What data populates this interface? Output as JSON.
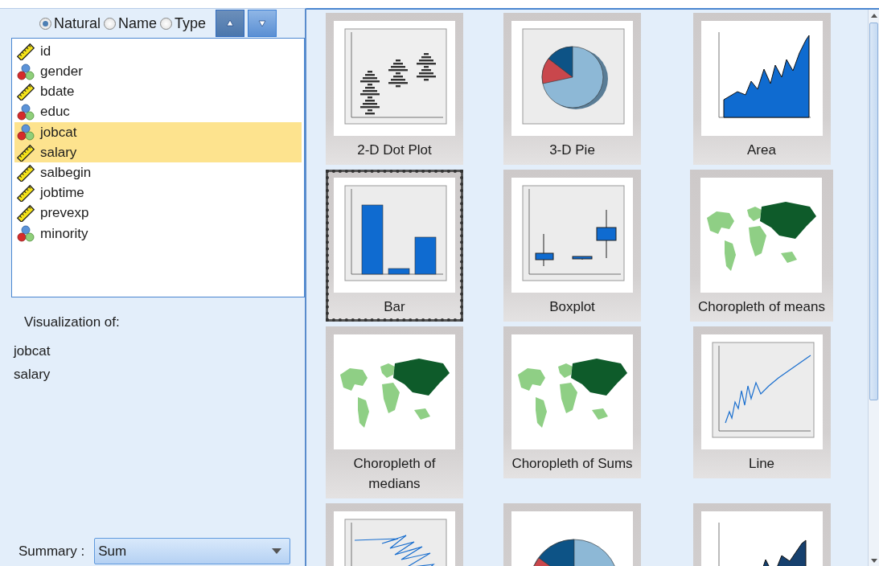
{
  "sort_options": [
    {
      "label": "Natural",
      "selected": true
    },
    {
      "label": "Name",
      "selected": false
    },
    {
      "label": "Type",
      "selected": false
    }
  ],
  "sort_buttons": [
    {
      "kind": "ascending",
      "selected": true
    },
    {
      "kind": "descending",
      "selected": false
    }
  ],
  "variables": [
    {
      "name": "id",
      "kind": "scale",
      "selected": false
    },
    {
      "name": "gender",
      "kind": "nominal",
      "selected": false
    },
    {
      "name": "bdate",
      "kind": "scale",
      "selected": false
    },
    {
      "name": "educ",
      "kind": "nominal",
      "selected": false
    },
    {
      "name": "jobcat",
      "kind": "nominal",
      "selected": true
    },
    {
      "name": "salary",
      "kind": "scale",
      "selected": true
    },
    {
      "name": "salbegin",
      "kind": "scale",
      "selected": false
    },
    {
      "name": "jobtime",
      "kind": "scale",
      "selected": false
    },
    {
      "name": "prevexp",
      "kind": "scale",
      "selected": false
    },
    {
      "name": "minority",
      "kind": "nominal",
      "selected": false
    }
  ],
  "visualization": {
    "label": "Visualization of:",
    "variables": [
      "jobcat",
      "salary"
    ]
  },
  "summary": {
    "label": "Summary :",
    "value": "Sum"
  },
  "gallery": [
    {
      "label": "2-D Dot Plot",
      "kind": "dotplot",
      "selected": false
    },
    {
      "label": "3-D Pie",
      "kind": "pie3d",
      "selected": false
    },
    {
      "label": "Area",
      "kind": "area",
      "selected": false
    },
    {
      "label": "Bar",
      "kind": "bar",
      "selected": true
    },
    {
      "label": "Boxplot",
      "kind": "boxplot",
      "selected": false
    },
    {
      "label": "Choropleth of means",
      "kind": "map",
      "selected": false
    },
    {
      "label": "Choropleth of medians",
      "kind": "map",
      "selected": false
    },
    {
      "label": "Choropleth of Sums",
      "kind": "map",
      "selected": false
    },
    {
      "label": "Line",
      "kind": "line",
      "selected": false
    },
    {
      "kind": "path",
      "selected": false
    },
    {
      "kind": "pie",
      "selected": false
    },
    {
      "kind": "stacked",
      "selected": false
    }
  ]
}
